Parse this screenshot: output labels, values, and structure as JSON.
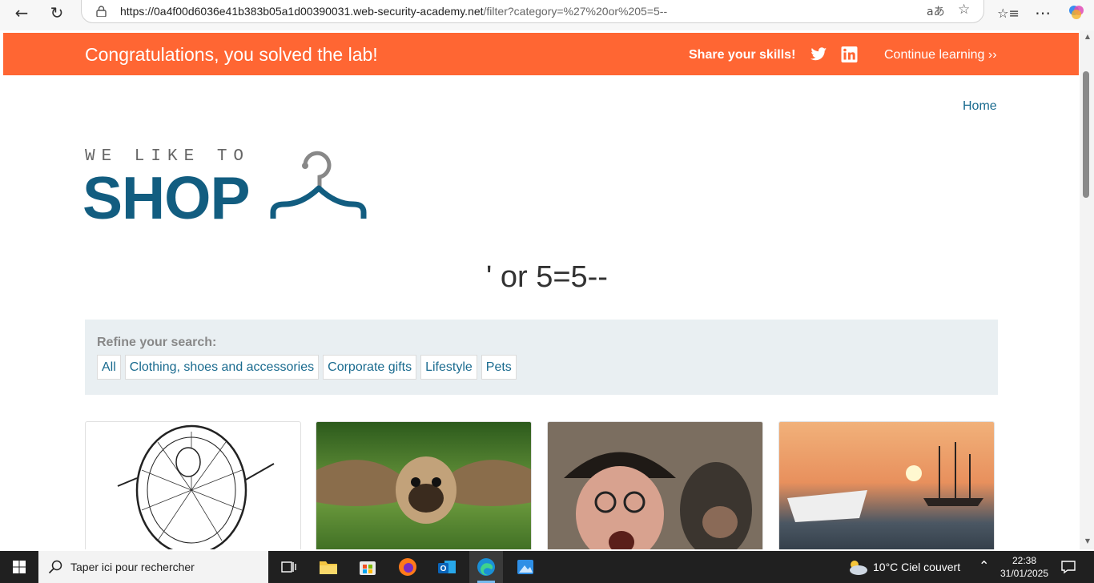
{
  "browser": {
    "url_host": "https://0a4f00d6036e41b383b05a1d00390031.web-security-academy.net",
    "url_rest": "/filter?category=%27%20or%205=5--",
    "read_aloud": "aあ"
  },
  "banner": {
    "title": "Congratulations, you solved the lab!",
    "share_label": "Share your skills!",
    "continue_label": "Continue learning ››"
  },
  "nav": {
    "home": "Home"
  },
  "logo": {
    "top": "WE LIKE TO",
    "main": "SHOP"
  },
  "search_title": "' or 5=5--",
  "refine": {
    "label": "Refine your search:",
    "filters": [
      "All",
      "Clothing, shoes and accessories",
      "Corporate gifts",
      "Lifestyle",
      "Pets"
    ]
  },
  "taskbar": {
    "search_placeholder": "Taper ici pour rechercher",
    "weather": "10°C  Ciel couvert",
    "time": "22:38",
    "date": "31/01/2025"
  },
  "colors": {
    "banner": "#ff6633",
    "brand": "#125d80",
    "link": "#1a6b8f"
  }
}
